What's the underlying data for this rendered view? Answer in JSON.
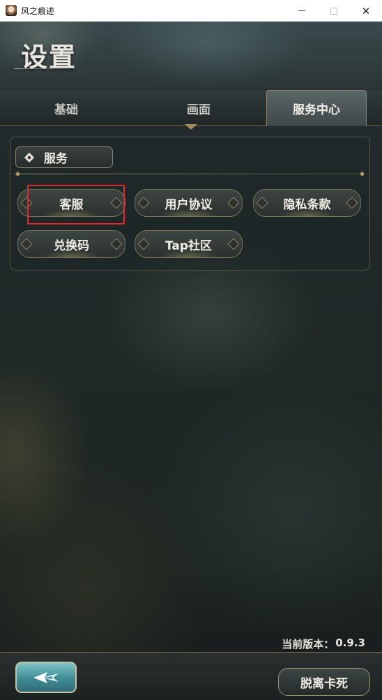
{
  "window": {
    "title": "风之痕迹",
    "minimize_icon": "minimize-icon",
    "maximize_icon": "maximize-icon",
    "close_glyph": "✕"
  },
  "page": {
    "title": "设置"
  },
  "tabs": [
    {
      "label": "基础",
      "active": false
    },
    {
      "label": "画面",
      "active": false
    },
    {
      "label": "服务中心",
      "active": true
    }
  ],
  "service_section": {
    "header": "服务",
    "icon": "diamond-icon",
    "buttons": [
      {
        "label": "客服",
        "highlighted": true
      },
      {
        "label": "用户协议"
      },
      {
        "label": "隐私条款"
      },
      {
        "label": "兑换码"
      },
      {
        "label": "Tap社区"
      }
    ]
  },
  "version": {
    "label": "当前版本：",
    "value": "0.9.3"
  },
  "footer": {
    "back_icon": "back-arrow-icon",
    "unstuck_label": "脱离卡死"
  },
  "colors": {
    "highlight": "#e8242c",
    "accent_gold": "#a48c5c",
    "back_button": "#3f8c96"
  }
}
